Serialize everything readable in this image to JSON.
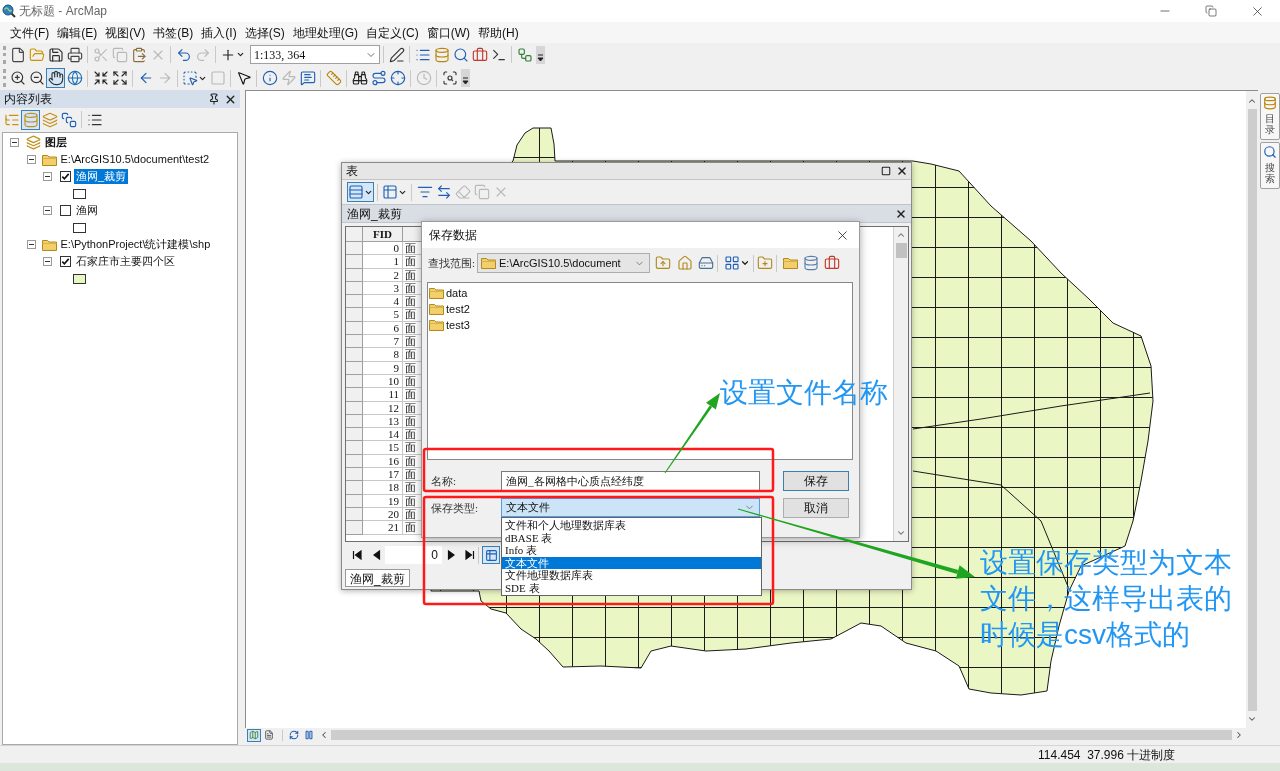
{
  "window": {
    "title": "无标题 - ArcMap"
  },
  "menu": [
    "文件(F)",
    "编辑(E)",
    "视图(V)",
    "书签(B)",
    "插入(I)",
    "选择(S)",
    "地理处理(G)",
    "自定义(C)",
    "窗口(W)",
    "帮助(H)"
  ],
  "toolbars": {
    "standard": [
      {
        "disabled": false
      },
      {
        "disabled": false
      },
      {
        "disabled": false
      },
      {
        "disabled": false
      },
      {
        "disabled": true
      },
      {
        "disabled": true
      },
      {
        "disabled": false
      },
      {
        "disabled": true
      },
      {
        "disabled": false
      },
      {
        "disabled": true
      },
      {
        "disabled": false
      },
      {
        "disabled": false
      },
      {
        "disabled": false
      },
      {
        "disabled": false
      },
      {
        "disabled": false
      },
      {
        "disabled": false
      },
      {
        "disabled": false
      },
      {
        "disabled": false
      }
    ],
    "scale": "1:133, 364",
    "tools": [
      {
        "selected": false,
        "disabled": false
      },
      {
        "selected": false,
        "disabled": false
      },
      {
        "selected": true,
        "disabled": false
      },
      {
        "selected": false,
        "disabled": false
      },
      {
        "selected": false,
        "disabled": false
      },
      {
        "selected": false,
        "disabled": false
      },
      {
        "selected": false,
        "disabled": false
      },
      {
        "selected": false,
        "disabled": true
      },
      {
        "selected": false,
        "disabled": false
      },
      {
        "selected": false,
        "disabled": true
      },
      {
        "selected": false,
        "disabled": false
      },
      {
        "selected": false,
        "disabled": false
      },
      {
        "selected": false,
        "disabled": true
      },
      {
        "selected": false,
        "disabled": false
      },
      {
        "selected": false,
        "disabled": false
      },
      {
        "selected": false,
        "disabled": false
      },
      {
        "selected": false,
        "disabled": false
      },
      {
        "selected": false,
        "disabled": false
      },
      {
        "selected": false,
        "disabled": true
      },
      {
        "selected": false,
        "disabled": false
      }
    ]
  },
  "toc": {
    "title": "内容列表",
    "view_buttons": [
      {
        "selected": false
      },
      {
        "selected": true
      },
      {
        "selected": false
      },
      {
        "selected": false
      }
    ],
    "tree": [
      {
        "label": "图层",
        "kind": "root",
        "expanded": true,
        "children": [
          {
            "label": "E:\\ArcGIS10.5\\document\\test2",
            "kind": "folder",
            "expanded": true,
            "children": [
              {
                "label": "渔网_裁剪",
                "kind": "layer",
                "expanded": true,
                "checked": true,
                "selected": true,
                "color": "#ffffff"
              },
              {
                "label": "渔网",
                "kind": "layer",
                "expanded": true,
                "checked": false,
                "selected": false,
                "color": "#ffffff"
              }
            ]
          },
          {
            "label": "E:\\PythonProject\\统计建模\\shp",
            "kind": "folder",
            "expanded": true,
            "children": [
              {
                "label": "石家庄市主要四个区",
                "kind": "layer",
                "expanded": true,
                "checked": true,
                "selected": false,
                "color": "#e6f7c4"
              }
            ]
          }
        ]
      }
    ]
  },
  "map_view_buttons": [
    {
      "selected": true
    },
    {
      "selected": false
    }
  ],
  "side_tabs": [
    {
      "label": "目录"
    },
    {
      "label": "搜索"
    }
  ],
  "table_window": {
    "title": "表",
    "tools": [
      {
        "selected": true,
        "disabled": false
      },
      {
        "selected": false,
        "disabled": false
      },
      {
        "selected": false,
        "disabled": false
      },
      {
        "selected": false,
        "disabled": false
      },
      {
        "selected": false,
        "disabled": true
      },
      {
        "selected": false,
        "disabled": true
      },
      {
        "selected": false,
        "disabled": true
      }
    ],
    "table_name": "渔网_裁剪",
    "columns": [
      "FID"
    ],
    "rows": [
      {
        "fid": "0",
        "column_2": "面"
      },
      {
        "fid": "1",
        "column_2": "面"
      },
      {
        "fid": "2",
        "column_2": "面"
      },
      {
        "fid": "3",
        "column_2": "面"
      },
      {
        "fid": "4",
        "column_2": "面"
      },
      {
        "fid": "5",
        "column_2": "面"
      },
      {
        "fid": "6",
        "column_2": "面"
      },
      {
        "fid": "7",
        "column_2": "面"
      },
      {
        "fid": "8",
        "column_2": "面"
      },
      {
        "fid": "9",
        "column_2": "面"
      },
      {
        "fid": "10",
        "column_2": "面"
      },
      {
        "fid": "11",
        "column_2": "面"
      },
      {
        "fid": "12",
        "column_2": "面"
      },
      {
        "fid": "13",
        "column_2": "面"
      },
      {
        "fid": "14",
        "column_2": "面"
      },
      {
        "fid": "15",
        "column_2": "面"
      },
      {
        "fid": "16",
        "column_2": "面"
      },
      {
        "fid": "17",
        "column_2": "面"
      },
      {
        "fid": "18",
        "column_2": "面"
      },
      {
        "fid": "19",
        "column_2": "面"
      },
      {
        "fid": "20",
        "column_2": "面"
      },
      {
        "fid": "21",
        "column_2": "面"
      }
    ],
    "record": "0",
    "tabs": [
      {
        "label": "渔网_裁剪",
        "selected": true
      }
    ]
  },
  "save_dialog": {
    "title": "保存数据",
    "look_in_label": "查找范围:",
    "look_in": "E:\\ArcGIS10.5\\document",
    "files": [
      {
        "name": "data"
      },
      {
        "name": "test2"
      },
      {
        "name": "test3"
      }
    ],
    "name_label": "名称:",
    "name": "渔网_各网格中心质点经纬度",
    "type_label": "保存类型:",
    "type": "文本文件",
    "buttons": [
      {
        "label": "保存",
        "default": true
      },
      {
        "label": "取消",
        "default": false
      }
    ],
    "type_options": [
      {
        "label": "文件和个人地理数据库表",
        "selected": false
      },
      {
        "label": "dBASE 表",
        "selected": false
      },
      {
        "label": "Info 表",
        "selected": false
      },
      {
        "label": "文本文件",
        "selected": true
      },
      {
        "label": "文件地理数据库表",
        "selected": false
      },
      {
        "label": "SDE 表",
        "selected": false
      }
    ]
  },
  "annotations": [
    {
      "text": "设置文件名称"
    },
    {
      "text": "设置保存类型为文本文件，这样导出表的时候是csv格式的"
    }
  ],
  "status_bar": {
    "coordinates": "114.454  37.996 十进制度"
  }
}
